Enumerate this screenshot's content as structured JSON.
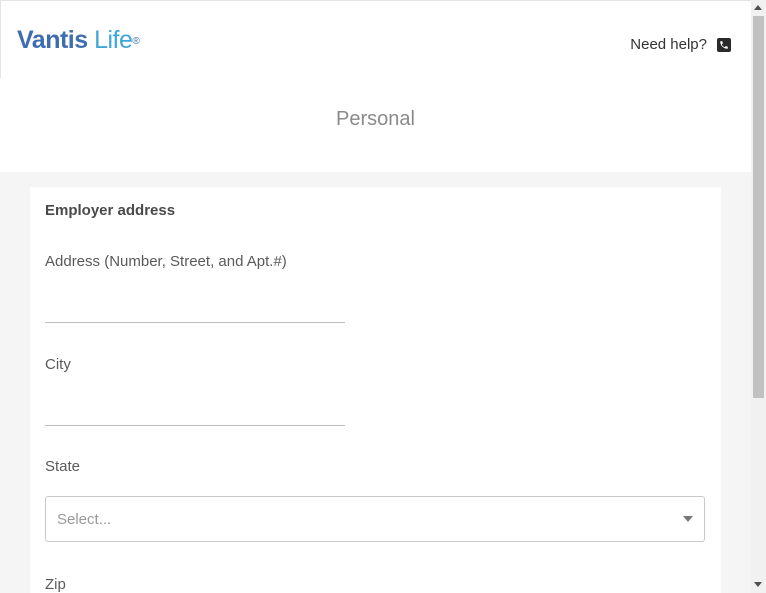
{
  "header": {
    "logo_part1": "Vantis",
    "logo_part2": " Life",
    "logo_reg": "®",
    "help_label": "Need help?",
    "help_icon": "phone-icon"
  },
  "page_title": "Personal",
  "form": {
    "section_title": "Employer address",
    "address_label": "Address (Number, Street, and Apt.#)",
    "address_value": "",
    "city_label": "City",
    "city_value": "",
    "state_label": "State",
    "state_placeholder": "Select...",
    "zip_label": "Zip"
  },
  "colors": {
    "brand_dark": "#3f6eb0",
    "brand_light": "#3fa6d9"
  }
}
